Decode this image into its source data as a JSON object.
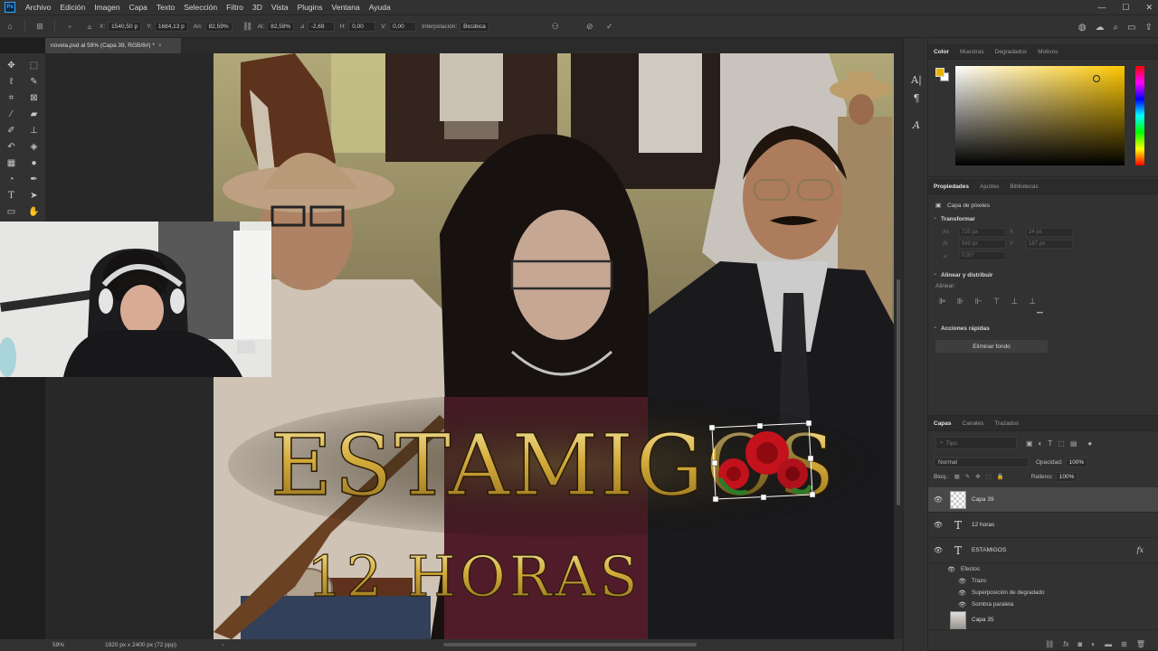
{
  "app": {
    "logo": "Ps"
  },
  "menu": [
    "Archivo",
    "Edición",
    "Imagen",
    "Capa",
    "Texto",
    "Selección",
    "Filtro",
    "3D",
    "Vista",
    "Plugins",
    "Ventana",
    "Ayuda"
  ],
  "window_controls": {
    "minimize": "—",
    "maximize": "☐",
    "close": "✕"
  },
  "options": {
    "x_label": "X:",
    "x": "1540,50 p",
    "y_label": "Y:",
    "y": "1684,13 p",
    "w_label": "An:",
    "w": "82,59%",
    "h_label": "Al:",
    "h": "82,59%",
    "angle_label": "⊿",
    "angle": "-2,69",
    "hskew_label": "H:",
    "hskew": "0,00",
    "vskew_label": "V:",
    "vskew": "0,00",
    "interp_label": "Interpolación:",
    "interp": "Bicúbica"
  },
  "doc_tab": {
    "title": "novela.psd al 59% (Capa 39, RGB/8#) *",
    "close": "×"
  },
  "artwork": {
    "title_text": "ESTAMIGOS",
    "subtitle_text": "12 HORAS",
    "title_color": "#c9a227"
  },
  "status": {
    "zoom": "59%",
    "info": "1920 px x 2400 px (72 ppp)",
    "arrow": "›"
  },
  "color_panel": {
    "tabs": [
      "Color",
      "Muestras",
      "Degradados",
      "Motivos"
    ],
    "foreground": "#e6b400",
    "background": "#ffffff"
  },
  "properties": {
    "tabs": [
      "Propiedades",
      "Ajustes",
      "Bibliotecas"
    ],
    "layer_kind": "Capa de píxeles",
    "transform_heading": "Transformar",
    "fields": [
      {
        "label": "An",
        "value": "720 px"
      },
      {
        "label": "X",
        "value": "24 px"
      },
      {
        "label": "Al",
        "value": "940 px"
      },
      {
        "label": "Y",
        "value": "187 px"
      },
      {
        "label": "⊿",
        "value": "0,00°"
      }
    ],
    "align_heading": "Alinear y distribuir",
    "align_label": "Alinear:",
    "more": "•••",
    "quick_heading": "Acciones rápidas",
    "remove_bg": "Eliminar fondo"
  },
  "layers": {
    "tabs": [
      "Capas",
      "Canales",
      "Trazados"
    ],
    "filter_placeholder": "Tipo",
    "blend": "Normal",
    "opacity_label": "Opacidad:",
    "opacity": "100%",
    "lock_label": "Bloq.:",
    "fill_label": "Relleno:",
    "fill": "100%",
    "items": [
      {
        "name": "Capa 39",
        "kind": "pixel",
        "selected": true
      },
      {
        "name": "12 horas",
        "kind": "text"
      },
      {
        "name": "ESTAMIGOS",
        "kind": "text",
        "fx": "fx"
      },
      {
        "name": "Capa 35",
        "kind": "photo"
      }
    ],
    "effects_heading": "Efectos",
    "effects": [
      "Trazo",
      "Superposición de degradado",
      "Sombra paralela"
    ]
  }
}
